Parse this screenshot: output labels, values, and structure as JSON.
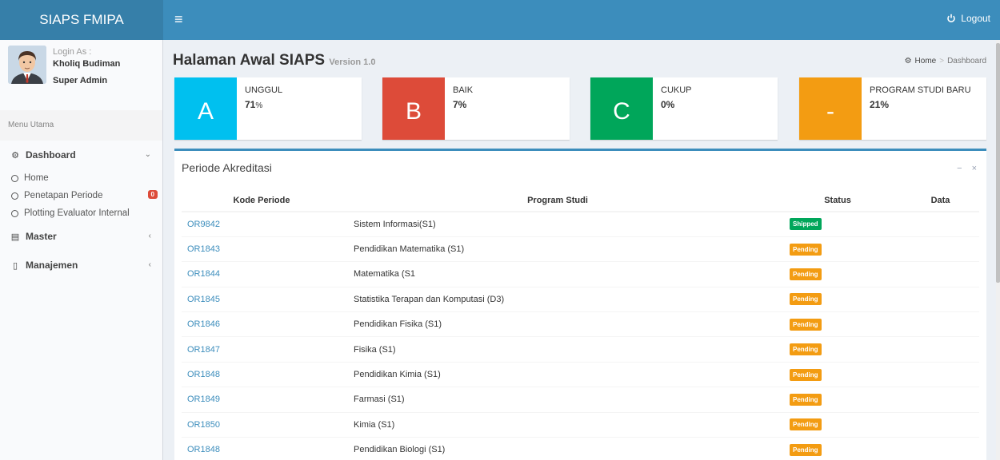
{
  "app": {
    "brand": "SIAPS FMIPA",
    "logout_label": "Logout"
  },
  "user": {
    "login_as_label": "Login As :",
    "name": "Kholiq Budiman",
    "role": "Super Admin"
  },
  "sidebar": {
    "menu_header": "Menu Utama",
    "dashboard": {
      "label": "Dashboard",
      "sub": [
        {
          "label": "Home"
        },
        {
          "label": "Penetapan Periode",
          "badge": "0"
        },
        {
          "label": "Plotting Evaluator Internal"
        }
      ]
    },
    "master": {
      "label": "Master"
    },
    "manajemen": {
      "label": "Manajemen"
    }
  },
  "page": {
    "title": "Halaman Awal SIAPS",
    "version": "Version 1.0"
  },
  "breadcrumb": {
    "home": "Home",
    "sep": ">",
    "current": "Dashboard"
  },
  "infoboxes": [
    {
      "icon_text": "A",
      "label": "UNGGUL",
      "value": "71",
      "unit": "%",
      "color": "#00c0ef"
    },
    {
      "icon_text": "B",
      "label": "BAIK",
      "value": "7%",
      "color": "#dd4b39"
    },
    {
      "icon_text": "C",
      "label": "CUKUP",
      "value": "0%",
      "color": "#00a65a"
    },
    {
      "icon_text": "-",
      "label": "PROGRAM STUDI BARU",
      "value": "21%",
      "color": "#f39c12"
    }
  ],
  "panel": {
    "title": "Periode Akreditasi",
    "tools": {
      "minimize": "−",
      "close": "×"
    },
    "columns": [
      "Kode Periode",
      "Program Studi",
      "Status",
      "Data"
    ],
    "rows": [
      {
        "kode": "OR9842",
        "program": "Sistem Informasi(S1)",
        "status": "Shipped"
      },
      {
        "kode": "OR1843",
        "program": "Pendidikan Matematika (S1)",
        "status": "Pending"
      },
      {
        "kode": "OR1844",
        "program": "Matematika (S1",
        "status": "Pending"
      },
      {
        "kode": "OR1845",
        "program": "Statistika Terapan dan Komputasi (D3)",
        "status": "Pending"
      },
      {
        "kode": "OR1846",
        "program": "Pendidikan Fisika (S1)",
        "status": "Pending"
      },
      {
        "kode": "OR1847",
        "program": "Fisika (S1)",
        "status": "Pending"
      },
      {
        "kode": "OR1848",
        "program": "Pendidikan Kimia (S1)",
        "status": "Pending"
      },
      {
        "kode": "OR1849",
        "program": "Farmasi (S1)",
        "status": "Pending"
      },
      {
        "kode": "OR1850",
        "program": "Kimia (S1)",
        "status": "Pending"
      },
      {
        "kode": "OR1848",
        "program": "Pendidikan Biologi (S1)",
        "status": "Pending"
      }
    ]
  },
  "colors": {
    "primary": "#3c8dbc",
    "logo_bg": "#367fa9",
    "shipped": "#00a65a",
    "pending": "#f39c12"
  }
}
